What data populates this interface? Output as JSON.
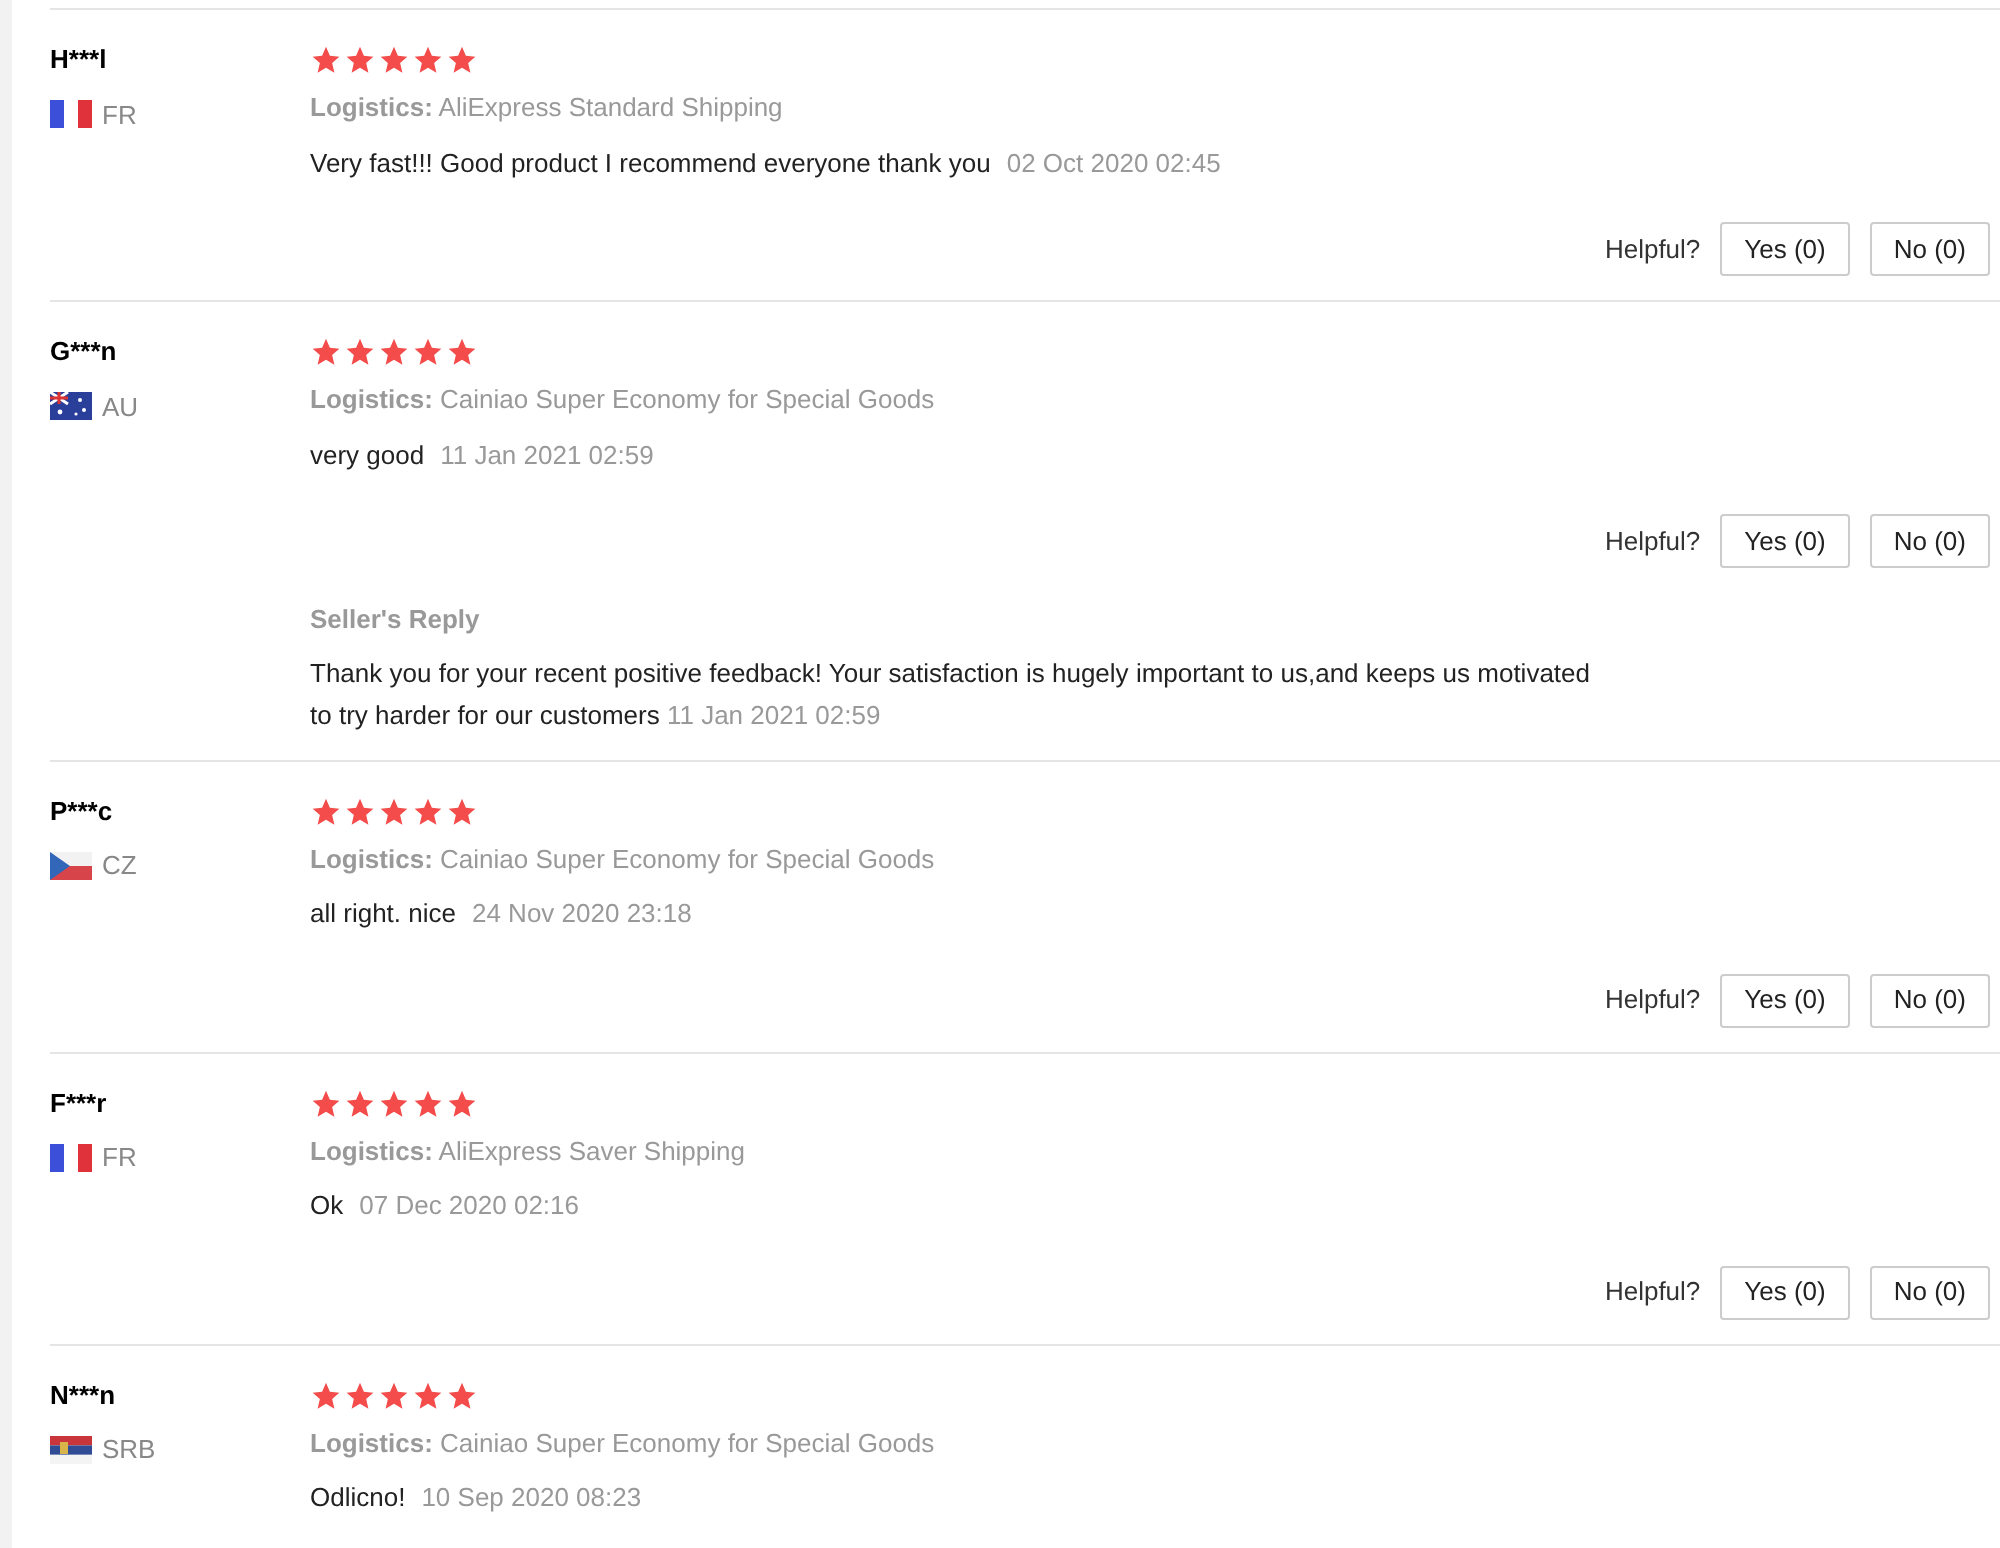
{
  "reviews": [
    {
      "name": "H***l",
      "flag": {
        "kind": "fr"
      },
      "country": "FR",
      "stars": 5,
      "logistics": "**Logistics:** AliExpress Standard Shipping",
      "text": "Very fast!!! Good product I recommend everyone thank you",
      "date": "02 Oct 2020 02:45",
      "helpful": {
        "label": "Helpful?",
        "yes": "Yes (0)",
        "no": "No (0)"
      }
    },
    {
      "name": "G***n",
      "flag": {
        "kind": "au"
      },
      "country": "AU",
      "stars": 5,
      "logistics": "**Logistics:** Cainiao Super Economy for Special Goods",
      "text": "very good",
      "date": "11 Jan 2021 02:59",
      "helpful": {
        "label": "Helpful?",
        "yes": "Yes (0)",
        "no": "No (0)"
      },
      "seller_reply": {
        "title": "Seller's Reply",
        "text": "Thank you for your recent positive feedback! Your satisfaction is hugely important to us,and keeps us motivated to try harder for our customers",
        "date": "11 Jan 2021 02:59"
      }
    },
    {
      "name": "P***c",
      "flag": {
        "kind": "cz"
      },
      "country": "CZ",
      "stars": 5,
      "logistics": "**Logistics:** Cainiao Super Economy for Special Goods",
      "text": "all right. nice",
      "date": "24 Nov 2020 23:18",
      "helpful": {
        "label": "Helpful?",
        "yes": "Yes (0)",
        "no": "No (0)"
      }
    },
    {
      "name": "F***r",
      "flag": {
        "kind": "fr"
      },
      "country": "FR",
      "stars": 5,
      "logistics": "**Logistics:** AliExpress Saver Shipping",
      "text": "Ok",
      "date": "07 Dec 2020 02:16",
      "helpful": {
        "label": "Helpful?",
        "yes": "Yes (0)",
        "no": "No (0)"
      }
    },
    {
      "name": "N***n",
      "flag": {
        "kind": "srb"
      },
      "country": "SRB",
      "stars": 5,
      "logistics": "**Logistics:** Cainiao Super Economy for Special Goods",
      "text": "Odlicno!",
      "date": "10 Sep 2020 08:23"
    }
  ]
}
